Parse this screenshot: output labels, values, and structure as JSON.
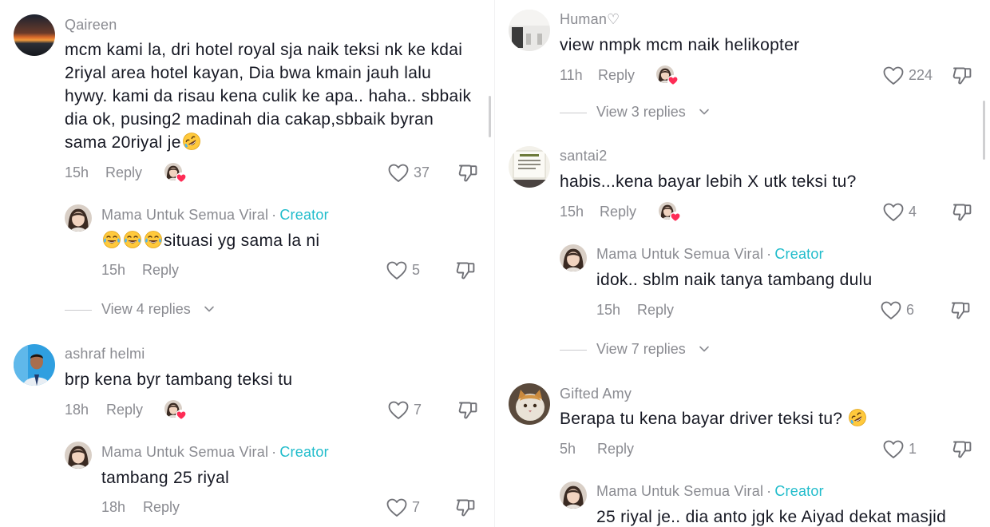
{
  "left": {
    "comments": [
      {
        "username": "Qaireen",
        "text": "mcm kami la, dri hotel royal sja naik teksi nk ke kdai 2riyal area hotel kayan, Dia bwa kmain jauh lalu hywy. kami da risau kena culik ke apa.. haha.. sbbaik dia ok, pusing2 madinah dia cakap,sbbaik byran sama 20riyal je",
        "emoji": "rofl",
        "time": "15h",
        "reply_label": "Reply",
        "likes": "37",
        "reply": {
          "username": "Mama Untuk Semua Viral",
          "creator_label": "Creator",
          "text": "situasi yg sama la ni",
          "emoji_prefix": [
            "joy",
            "joy",
            "joy"
          ],
          "time": "15h",
          "reply_label": "Reply",
          "likes": "5"
        },
        "view_replies": "View 4 replies"
      },
      {
        "username": "ashraf helmi",
        "text": "brp kena byr tambang teksi tu",
        "time": "18h",
        "reply_label": "Reply",
        "likes": "7",
        "reply": {
          "username": "Mama Untuk Semua Viral",
          "creator_label": "Creator",
          "text": "tambang 25 riyal",
          "time": "18h",
          "reply_label": "Reply",
          "likes": "7"
        }
      }
    ]
  },
  "right": {
    "comments": [
      {
        "username": "Human♡",
        "text": "view nmpk mcm naik helikopter",
        "time": "11h",
        "reply_label": "Reply",
        "likes": "224",
        "view_replies": "View 3 replies"
      },
      {
        "username": "santai2",
        "text": "habis...kena bayar lebih X utk teksi tu?",
        "time": "15h",
        "reply_label": "Reply",
        "likes": "4",
        "reply": {
          "username": "Mama Untuk Semua Viral",
          "creator_label": "Creator",
          "text": "idok.. sblm naik tanya tambang dulu",
          "time": "15h",
          "reply_label": "Reply",
          "likes": "6"
        },
        "view_replies": "View 7 replies"
      },
      {
        "username": "Gifted Amy",
        "text": "Berapa tu kena bayar driver teksi tu?",
        "emoji": "rofl",
        "time": "5h",
        "reply_label": "Reply",
        "likes": "1",
        "reply": {
          "username": "Mama Untuk Semua Viral",
          "creator_label": "Creator",
          "text": "25 riyal je.. dia anto jgk ke Aiyad dekat masjid"
        }
      }
    ]
  },
  "colors": {
    "creator_accent": "#20bccb",
    "secondary_text": "#8a8b91",
    "primary_text": "#161823",
    "creator_liked_heart": "#fe2c55"
  },
  "icons": [
    "heart-outline-icon",
    "dislike-icon",
    "chevron-down-icon",
    "creator-liked-heart-icon"
  ]
}
